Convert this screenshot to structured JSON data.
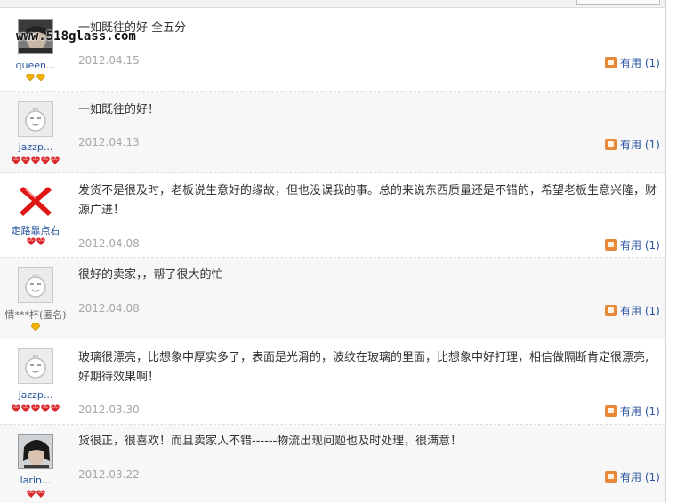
{
  "watermark": "www.518glass.com",
  "useful_label": "有用",
  "reviews": [
    {
      "user": "queen...",
      "avatar": "photo-avatar",
      "badge_type": "diamond",
      "badge_count": 2,
      "content": "一如既往的好 全五分",
      "date": "2012.04.15",
      "useful_count": "(1)"
    },
    {
      "user": "jazzp...",
      "avatar": "default-face-avatar",
      "badge_type": "heart",
      "badge_count": 5,
      "content": "一如既往的好！",
      "date": "2012.04.13",
      "useful_count": "(1)"
    },
    {
      "user": "走路靠点右",
      "avatar": "red-x-avatar",
      "badge_type": "heart",
      "badge_count": 2,
      "content": "发货不是很及时，老板说生意好的缘故，但也没误我的事。总的来说东西质量还是不错的，希望老板生意兴隆，财源广进！",
      "date": "2012.04.08",
      "useful_count": "(1)"
    },
    {
      "user": "情***杯(匿名)",
      "avatar": "default-face-avatar",
      "badge_type": "diamond",
      "badge_count": 1,
      "content": "很好的卖家，，帮了很大的忙",
      "date": "2012.04.08",
      "useful_count": "(1)"
    },
    {
      "user": "jazzp...",
      "avatar": "default-face-avatar",
      "badge_type": "heart",
      "badge_count": 5,
      "content": "玻璃很漂亮，比想象中厚实多了，表面是光滑的，波纹在玻璃的里面，比想象中好打理，相信做隔断肯定很漂亮,好期待效果啊！",
      "date": "2012.03.30",
      "useful_count": "(1)"
    },
    {
      "user": "larin...",
      "avatar": "photo-avatar",
      "badge_type": "heart",
      "badge_count": 2,
      "content": "货很正，很喜欢！而且卖家人不错------物流出现问题也及时处理，很满意！",
      "date": "2012.03.22",
      "useful_count": "(1)"
    }
  ],
  "colors": {
    "link": "#2b55a0",
    "date": "#a7a7a7",
    "heart": "#d9262b",
    "diamond": "#f0b400",
    "useful_icon": "#e8893a"
  }
}
